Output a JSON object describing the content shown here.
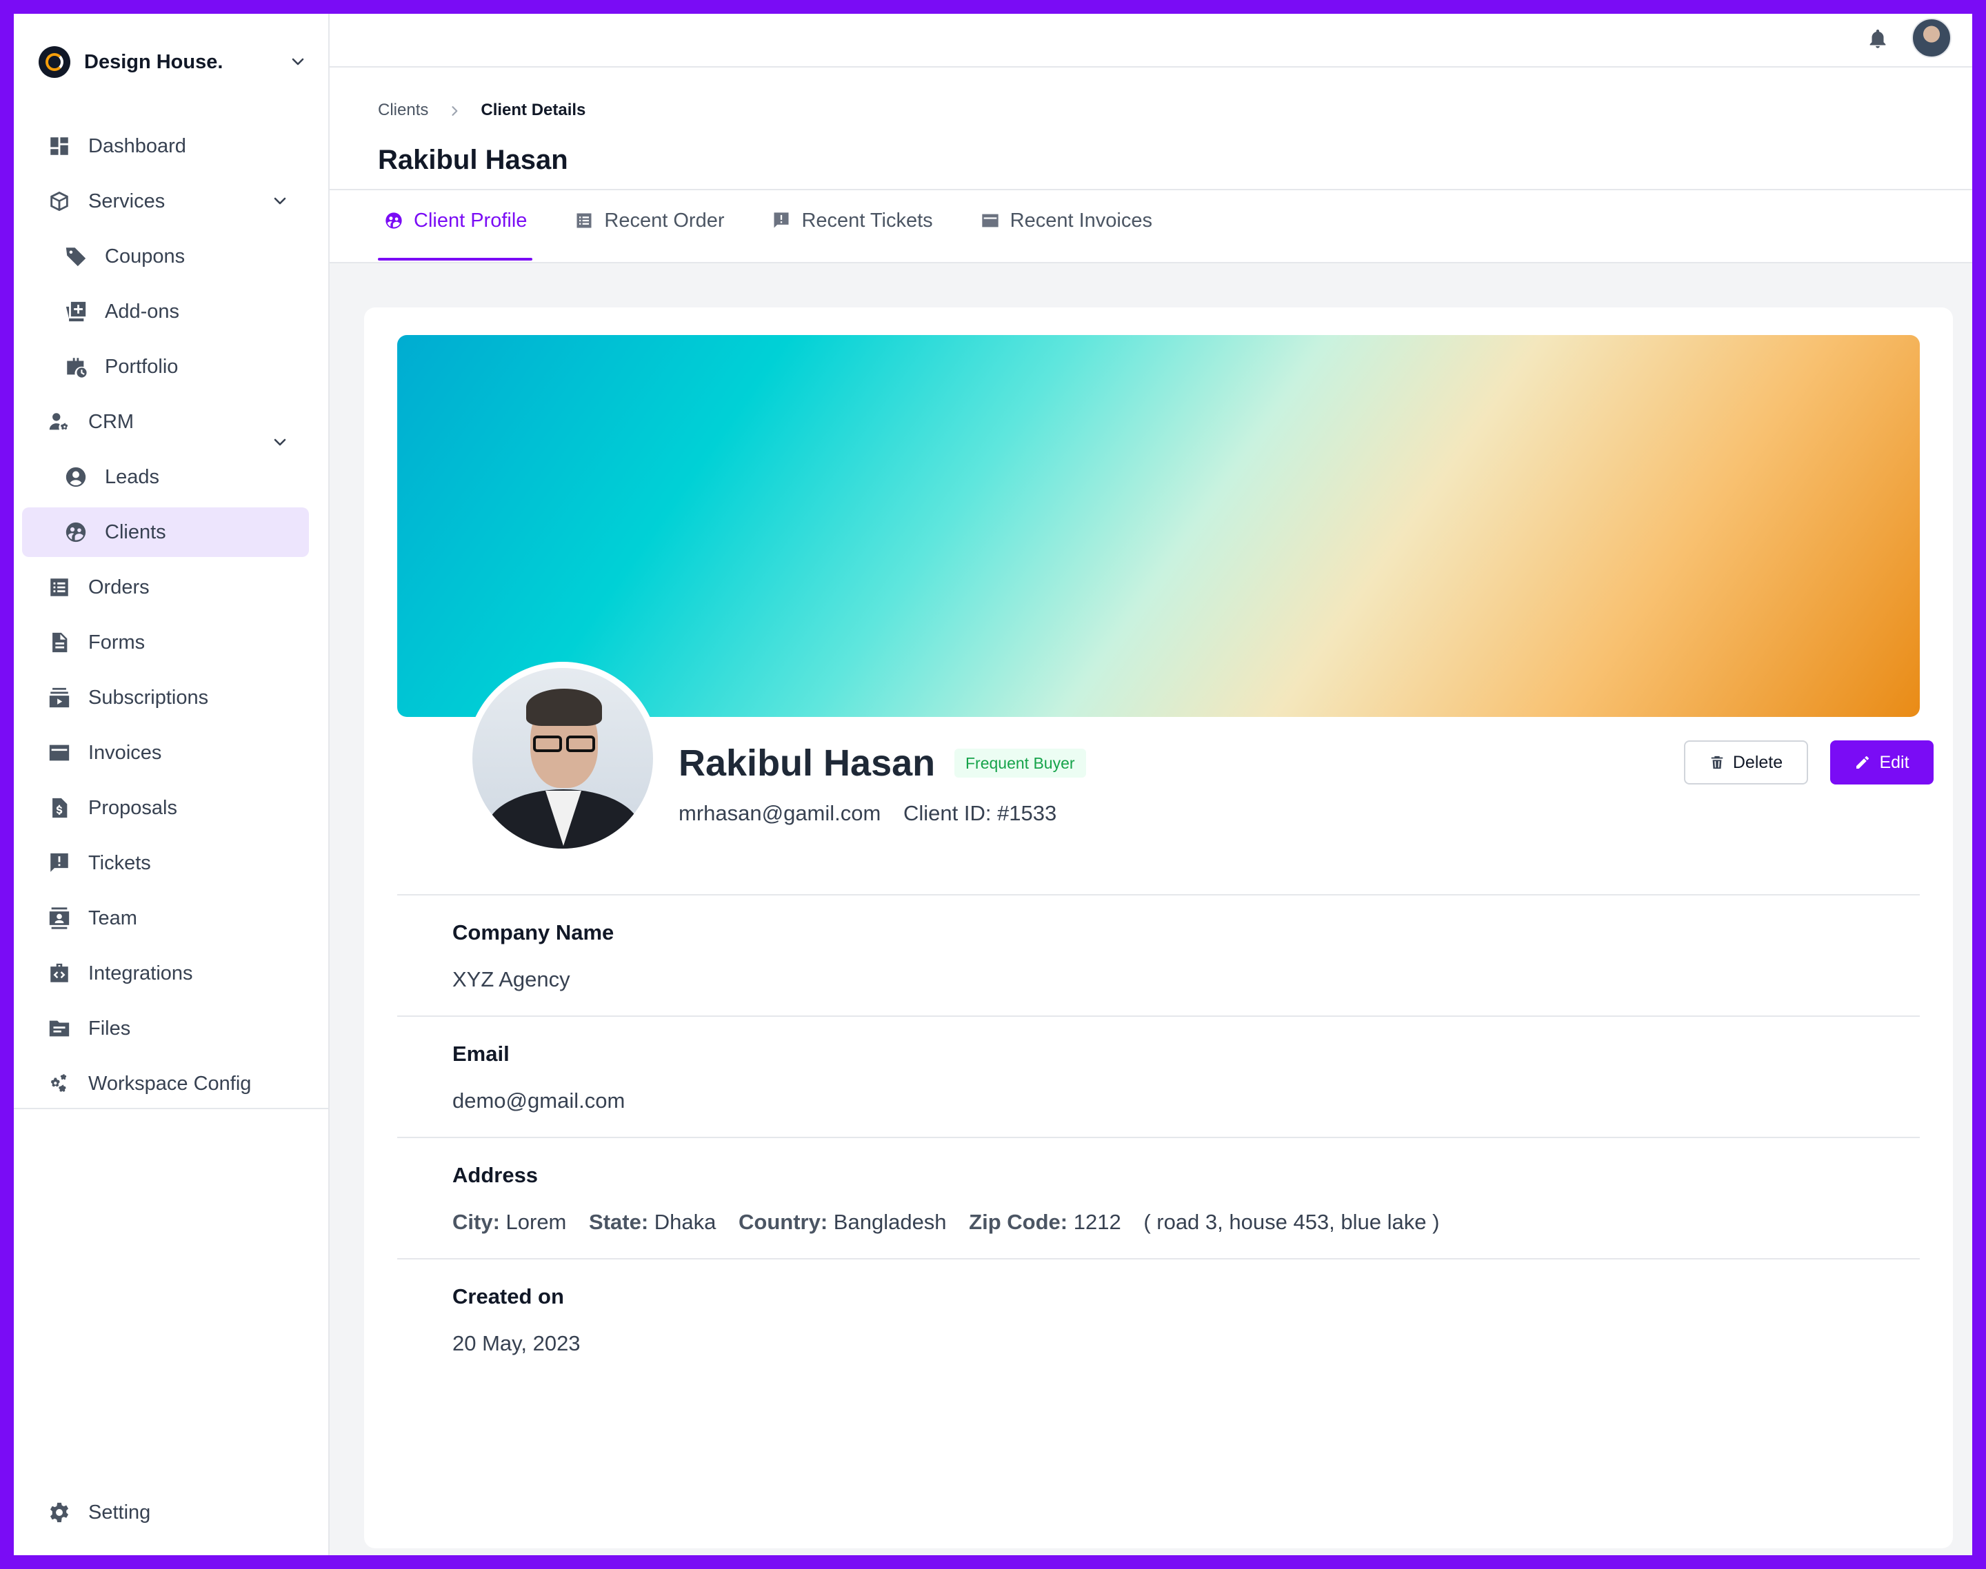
{
  "brand": {
    "name": "Design House."
  },
  "sidebar": {
    "items": [
      {
        "label": "Dashboard",
        "icon": "dashboard-icon"
      },
      {
        "label": "Services",
        "icon": "cube-icon",
        "expandable": true
      },
      {
        "label": "Coupons",
        "icon": "tag-icon",
        "sub": true
      },
      {
        "label": "Add-ons",
        "icon": "add-box-icon",
        "sub": true
      },
      {
        "label": "Portfolio",
        "icon": "briefcase-icon",
        "sub": true
      },
      {
        "label": "CRM",
        "icon": "user-gear-icon",
        "expandable": true
      },
      {
        "label": "Leads",
        "icon": "user-circle-icon",
        "sub": true
      },
      {
        "label": "Clients",
        "icon": "users-circle-icon",
        "sub": true,
        "active": true
      },
      {
        "label": "Orders",
        "icon": "list-icon"
      },
      {
        "label": "Forms",
        "icon": "document-icon"
      },
      {
        "label": "Subscriptions",
        "icon": "subscriptions-icon"
      },
      {
        "label": "Invoices",
        "icon": "credit-card-icon"
      },
      {
        "label": "Proposals",
        "icon": "dollar-document-icon"
      },
      {
        "label": "Tickets",
        "icon": "chat-alert-icon"
      },
      {
        "label": "Team",
        "icon": "contact-icon"
      },
      {
        "label": "Integrations",
        "icon": "code-bag-icon"
      },
      {
        "label": "Files",
        "icon": "folder-icon"
      },
      {
        "label": "Workspace Config",
        "icon": "gears-icon"
      }
    ],
    "bottom": {
      "label": "Setting",
      "icon": "gear-icon"
    }
  },
  "breadcrumb": {
    "parent": "Clients",
    "current": "Client Details"
  },
  "page": {
    "title": "Rakibul Hasan"
  },
  "tabs": [
    {
      "label": "Client Profile",
      "icon": "users-circle-icon",
      "active": true
    },
    {
      "label": "Recent Order",
      "icon": "list-icon"
    },
    {
      "label": "Recent Tickets",
      "icon": "chat-alert-icon"
    },
    {
      "label": "Recent Invoices",
      "icon": "credit-card-icon"
    }
  ],
  "profile": {
    "name": "Rakibul Hasan",
    "badge": "Frequent Buyer",
    "email": "mrhasan@gamil.com",
    "client_id": "Client ID: #1533",
    "delete_label": "Delete",
    "edit_label": "Edit"
  },
  "details": {
    "company": {
      "heading": "Company Name",
      "value": "XYZ Agency"
    },
    "email": {
      "heading": "Email",
      "value": "demo@gmail.com"
    },
    "address": {
      "heading": "Address",
      "city_label": "City:",
      "city": "Lorem",
      "state_label": "State:",
      "state": "Dhaka",
      "country_label": "Country:",
      "country": "Bangladesh",
      "zip_label": "Zip Code:",
      "zip": "1212",
      "street": "( road 3, house 453, blue lake )"
    },
    "created": {
      "heading": "Created on",
      "value": "20 May, 2023"
    }
  },
  "colors": {
    "accent": "#7a0cf5",
    "badge_text": "#16a34a",
    "badge_bg": "#ecfdf3"
  }
}
